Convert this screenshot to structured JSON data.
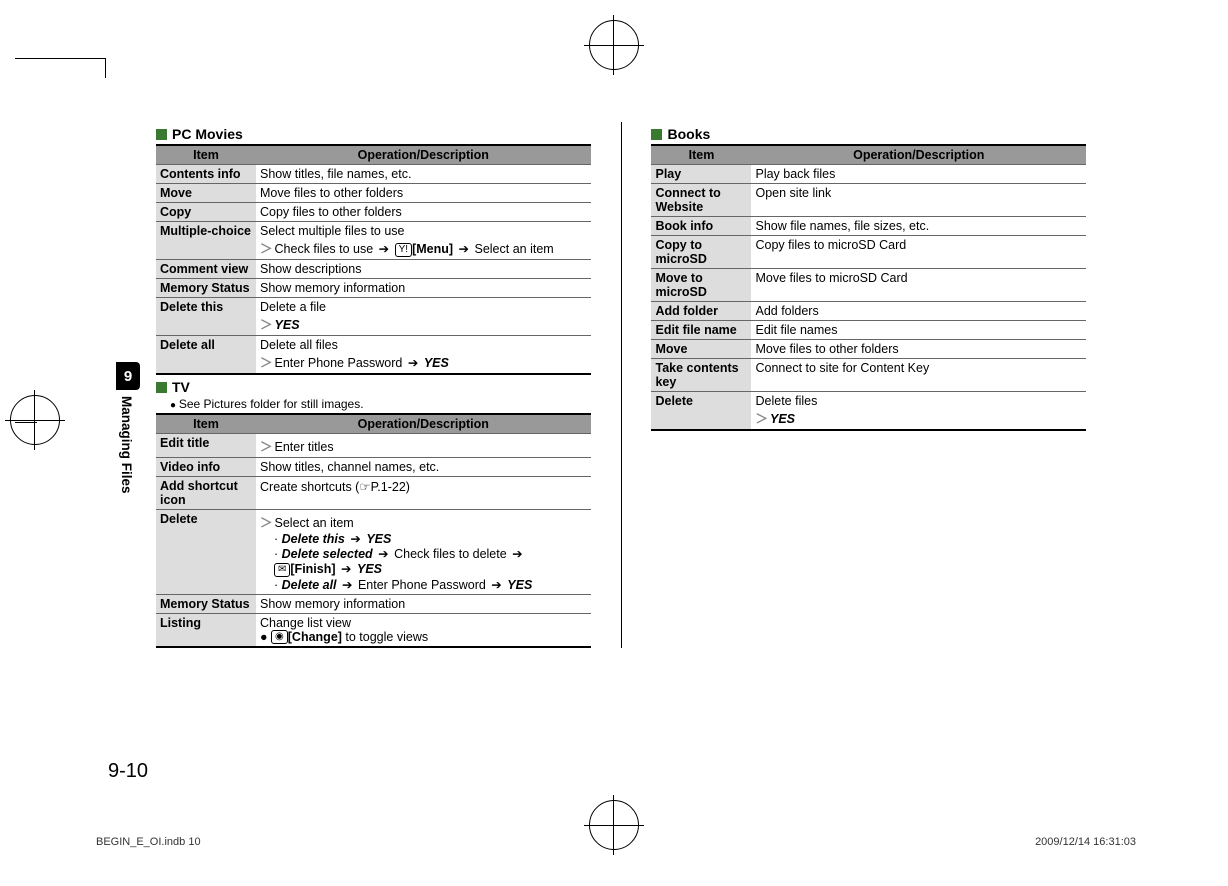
{
  "chapter": {
    "number": "9",
    "label": "Managing Files"
  },
  "pageNumber": "9-10",
  "footer": {
    "left": "BEGIN_E_OI.indb   10",
    "right": "2009/12/14   16:31:03"
  },
  "left": {
    "sections": [
      {
        "title": "PC Movies",
        "note": null,
        "headers": [
          "Item",
          "Operation/Description"
        ],
        "rows": [
          {
            "label": "Contents info",
            "desc": [
              {
                "t": "Show titles, file names, etc."
              }
            ]
          },
          {
            "label": "Move",
            "desc": [
              {
                "t": "Move files to other folders"
              }
            ]
          },
          {
            "label": "Copy",
            "desc": [
              {
                "t": "Copy files to other folders"
              }
            ]
          },
          {
            "label": "Multiple-choice",
            "desc": [
              {
                "t": "Select multiple files to use"
              },
              {
                "gt": true,
                "segs": [
                  "Check files to use ",
                  {
                    "arrow": true
                  },
                  " ",
                  {
                    "key": "Y!"
                  },
                  {
                    "b": "[Menu]"
                  },
                  " ",
                  {
                    "arrow": true
                  },
                  " Select an item"
                ]
              }
            ]
          },
          {
            "label": "Comment view",
            "desc": [
              {
                "t": "Show descriptions"
              }
            ]
          },
          {
            "label": "Memory Status",
            "desc": [
              {
                "t": "Show memory information"
              }
            ]
          },
          {
            "label": "Delete this",
            "desc": [
              {
                "t": "Delete a file"
              },
              {
                "gt": true,
                "segs": [
                  {
                    "bi": "YES"
                  }
                ]
              }
            ]
          },
          {
            "label": "Delete all",
            "desc": [
              {
                "t": "Delete all files"
              },
              {
                "gt": true,
                "segs": [
                  "Enter Phone Password ",
                  {
                    "arrow": true
                  },
                  " ",
                  {
                    "bi": "YES"
                  }
                ]
              }
            ]
          }
        ]
      },
      {
        "title": "TV",
        "note": "See Pictures folder for still images.",
        "headers": [
          "Item",
          "Operation/Description"
        ],
        "rows": [
          {
            "label": "Edit title",
            "desc": [
              {
                "gt": true,
                "segs": [
                  "Enter titles"
                ]
              }
            ]
          },
          {
            "label": "Video info",
            "desc": [
              {
                "t": "Show titles, channel names, etc."
              }
            ]
          },
          {
            "label": "Add shortcut icon",
            "desc": [
              {
                "segs": [
                  "Create shortcuts (",
                  {
                    "ref": "☞"
                  },
                  "P.1-22)"
                ]
              }
            ]
          },
          {
            "label": "Delete",
            "desc": [
              {
                "gt": true,
                "segs": [
                  "Select an item"
                ]
              },
              {
                "sub": true,
                "segs": [
                  "· ",
                  {
                    "bi": "Delete this"
                  },
                  " ",
                  {
                    "arrow": true
                  },
                  " ",
                  {
                    "bi": "YES"
                  }
                ]
              },
              {
                "sub": true,
                "segs": [
                  "· ",
                  {
                    "bi": "Delete selected"
                  },
                  " ",
                  {
                    "arrow": true
                  },
                  " Check files to delete ",
                  {
                    "arrow": true
                  },
                  " "
                ]
              },
              {
                "sub": true,
                "segs": [
                  "  ",
                  {
                    "key": "✉"
                  },
                  {
                    "b": "[Finish]"
                  },
                  " ",
                  {
                    "arrow": true
                  },
                  " ",
                  {
                    "bi": "YES"
                  }
                ]
              },
              {
                "sub": true,
                "segs": [
                  "· ",
                  {
                    "bi": "Delete all"
                  },
                  " ",
                  {
                    "arrow": true
                  },
                  " Enter Phone Password ",
                  {
                    "arrow": true
                  },
                  " ",
                  {
                    "bi": "YES"
                  }
                ]
              }
            ]
          },
          {
            "label": "Memory Status",
            "desc": [
              {
                "t": "Show memory information"
              }
            ]
          },
          {
            "label": "Listing",
            "desc": [
              {
                "t": "Change list view"
              },
              {
                "segs": [
                  "● ",
                  {
                    "key": "◉"
                  },
                  {
                    "b": "[Change]"
                  },
                  " to toggle views"
                ]
              }
            ]
          }
        ]
      }
    ]
  },
  "right": {
    "sections": [
      {
        "title": "Books",
        "note": null,
        "headers": [
          "Item",
          "Operation/Description"
        ],
        "rows": [
          {
            "label": "Play",
            "desc": [
              {
                "t": "Play back files"
              }
            ]
          },
          {
            "label": "Connect to Website",
            "desc": [
              {
                "t": "Open site link"
              }
            ]
          },
          {
            "label": "Book info",
            "desc": [
              {
                "t": "Show file names, file sizes, etc."
              }
            ]
          },
          {
            "label": "Copy to microSD",
            "desc": [
              {
                "t": "Copy files to microSD Card"
              }
            ]
          },
          {
            "label": "Move to microSD",
            "desc": [
              {
                "t": "Move files to microSD Card"
              }
            ]
          },
          {
            "label": "Add folder",
            "desc": [
              {
                "t": "Add folders"
              }
            ]
          },
          {
            "label": "Edit file name",
            "desc": [
              {
                "t": "Edit file names"
              }
            ]
          },
          {
            "label": "Move",
            "desc": [
              {
                "t": "Move files to other folders"
              }
            ]
          },
          {
            "label": "Take contents key",
            "desc": [
              {
                "t": "Connect to site for Content Key"
              }
            ]
          },
          {
            "label": "Delete",
            "desc": [
              {
                "t": "Delete files"
              },
              {
                "gt": true,
                "segs": [
                  {
                    "bi": "YES"
                  }
                ]
              }
            ]
          }
        ]
      }
    ]
  }
}
